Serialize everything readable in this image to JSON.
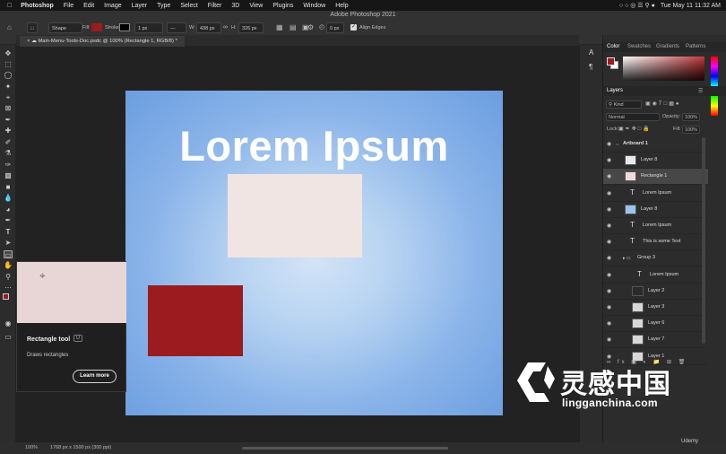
{
  "menubar": {
    "items": [
      "Photoshop",
      "File",
      "Edit",
      "Image",
      "Layer",
      "Type",
      "Select",
      "Filter",
      "3D",
      "View",
      "Plugins",
      "Window",
      "Help"
    ],
    "datetime": "Tue May 11  11:32 AM"
  },
  "options": {
    "window_title": "Adobe Photoshop 2021",
    "mode": "Shape",
    "fill_label": "Fill:",
    "stroke_label": "Stroke:",
    "stroke_width": "1 px",
    "w_label": "W:",
    "w_value": "438 px",
    "h_label": "H:",
    "h_value": "326 px",
    "radius_value": "0 px",
    "align_edges": "Align Edges",
    "fill_color": "#9c1b1f"
  },
  "document": {
    "tab_title": "Main-Menu-Tools-Doc.psdc @ 100% (Rectangle 1, RGB/8) *",
    "artboard_text": "Lorem Ipsum",
    "pink_color": "#f1e5e4",
    "red_color": "#9c1b1f"
  },
  "tooltip": {
    "title": "Rectangle tool",
    "shortcut": "U",
    "description": "Draws rectangles",
    "learn_more": "Learn more"
  },
  "status": {
    "zoom": "100%",
    "size": "1768 px x 1500 px (300 ppi)"
  },
  "color_panel": {
    "tabs": [
      "Color",
      "Swatches",
      "Gradients",
      "Patterns"
    ],
    "foreground": "#9c1b1f",
    "background": "#ffffff"
  },
  "layers_panel": {
    "tab": "Layers",
    "filter_kind": "Kind",
    "blend_mode": "Normal",
    "opacity_label": "Opacity:",
    "opacity_value": "100%",
    "lock_label": "Lock:",
    "fill_label": "Fill:",
    "fill_value": "100%",
    "layers": [
      {
        "name": "Artboard 1",
        "kind": "artboard"
      },
      {
        "name": "Layer 8",
        "kind": "pixel"
      },
      {
        "name": "Rectangle 1",
        "kind": "shape",
        "selected": true
      },
      {
        "name": "Lorem Ipsum",
        "kind": "text"
      },
      {
        "name": "Layer 8",
        "kind": "pixel"
      },
      {
        "name": "Lorem Ipsum",
        "kind": "text"
      },
      {
        "name": "This is some Text",
        "kind": "text"
      },
      {
        "name": "Group 3",
        "kind": "group"
      },
      {
        "name": "Lorem Ipsum",
        "kind": "text"
      },
      {
        "name": "Layer 2",
        "kind": "pixel"
      },
      {
        "name": "Layer 3",
        "kind": "pixel"
      },
      {
        "name": "Layer 6",
        "kind": "pixel"
      },
      {
        "name": "Layer 7",
        "kind": "pixel"
      },
      {
        "name": "Layer 1",
        "kind": "pixel"
      }
    ]
  },
  "watermark": {
    "cn": "灵感中国",
    "url": "lingganchina.com",
    "udemy": "Udemy"
  }
}
